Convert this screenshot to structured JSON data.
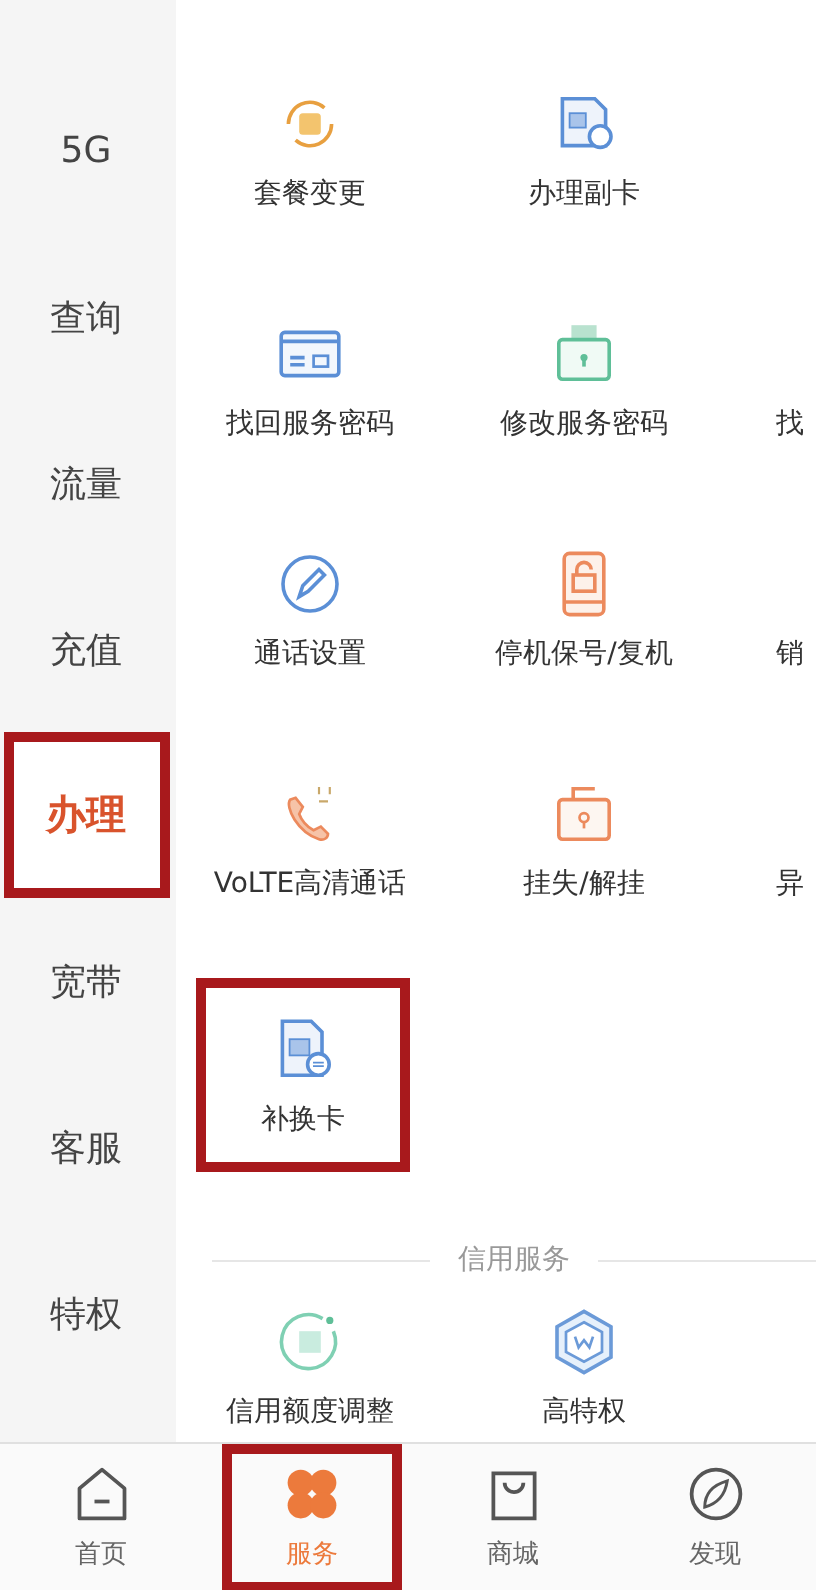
{
  "sidebar": {
    "items": [
      {
        "label": "5G",
        "selected": false,
        "highlighted": false
      },
      {
        "label": "查询",
        "selected": false,
        "highlighted": false
      },
      {
        "label": "流量",
        "selected": false,
        "highlighted": false
      },
      {
        "label": "充值",
        "selected": false,
        "highlighted": false
      },
      {
        "label": "办理",
        "selected": true,
        "highlighted": true
      },
      {
        "label": "宽带",
        "selected": false,
        "highlighted": false
      },
      {
        "label": "客服",
        "selected": false,
        "highlighted": false
      },
      {
        "label": "特权",
        "selected": false,
        "highlighted": false
      }
    ]
  },
  "service_rows": [
    {
      "items": [
        {
          "label": "套餐变更",
          "highlighted": false
        },
        {
          "label": "办理副卡",
          "highlighted": false
        }
      ]
    },
    {
      "items": [
        {
          "label": "找回服务密码",
          "highlighted": false
        },
        {
          "label": "修改服务密码",
          "highlighted": false
        }
      ],
      "edge_label": "找"
    },
    {
      "items": [
        {
          "label": "通话设置",
          "highlighted": false
        },
        {
          "label": "停机保号/复机",
          "highlighted": false
        }
      ],
      "edge_label": "销"
    },
    {
      "items": [
        {
          "label": "VoLTE高清通话",
          "highlighted": false
        },
        {
          "label": "挂失/解挂",
          "highlighted": false
        }
      ],
      "edge_label": "异"
    },
    {
      "items": [
        {
          "label": "补换卡",
          "highlighted": true
        }
      ]
    }
  ],
  "credit_section": {
    "title": "信用服务",
    "items": [
      {
        "label": "信用额度调整"
      },
      {
        "label": "高特权"
      }
    ]
  },
  "tab_bar": [
    {
      "label": "首页",
      "selected": false,
      "highlighted": false
    },
    {
      "label": "服务",
      "selected": true,
      "highlighted": true
    },
    {
      "label": "商城",
      "selected": false,
      "highlighted": false
    },
    {
      "label": "发现",
      "selected": false,
      "highlighted": false
    }
  ]
}
